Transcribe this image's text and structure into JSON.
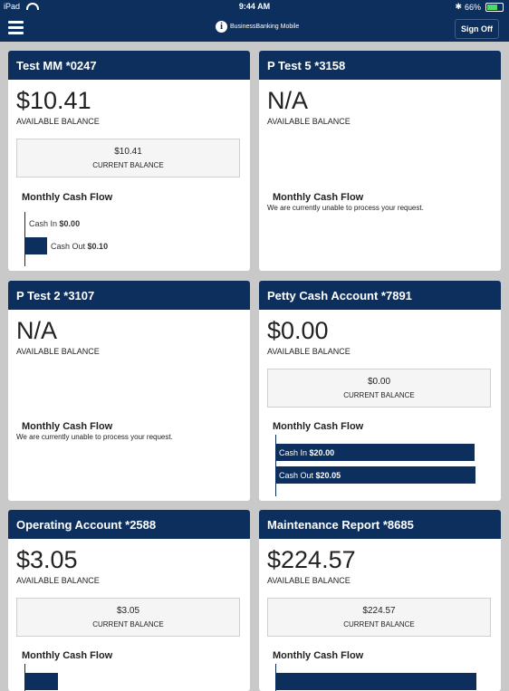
{
  "status": {
    "device": "iPad",
    "time": "9:44 AM",
    "battery": "66%",
    "battery_level": 0.66
  },
  "header": {
    "logo_letter": "i",
    "brand": "BusinessBanking Mobile",
    "signoff_label": "Sign Off"
  },
  "labels": {
    "available_balance": "AVAILABLE BALANCE",
    "current_balance": "CURRENT BALANCE",
    "monthly_cash_flow": "Monthly Cash Flow",
    "unable": "We are currently unable to process your request.",
    "cash_in": "Cash In",
    "cash_out": "Cash Out"
  },
  "accounts": [
    {
      "name": "Test MM *0247",
      "available": "$10.41",
      "current": "$10.41",
      "cash_in": "$0.00",
      "cash_out": "$0.10"
    },
    {
      "name": "P Test 5 *3158",
      "available": "N/A"
    },
    {
      "name": "P Test 2 *3107",
      "available": "N/A"
    },
    {
      "name": "Petty Cash Account *7891",
      "available": "$0.00",
      "current": "$0.00",
      "cash_in": "$20.00",
      "cash_out": "$20.05"
    },
    {
      "name": "Operating Account *2588",
      "available": "$3.05",
      "current": "$3.05"
    },
    {
      "name": "Maintenance Report *8685",
      "available": "$224.57",
      "current": "$224.57"
    }
  ]
}
